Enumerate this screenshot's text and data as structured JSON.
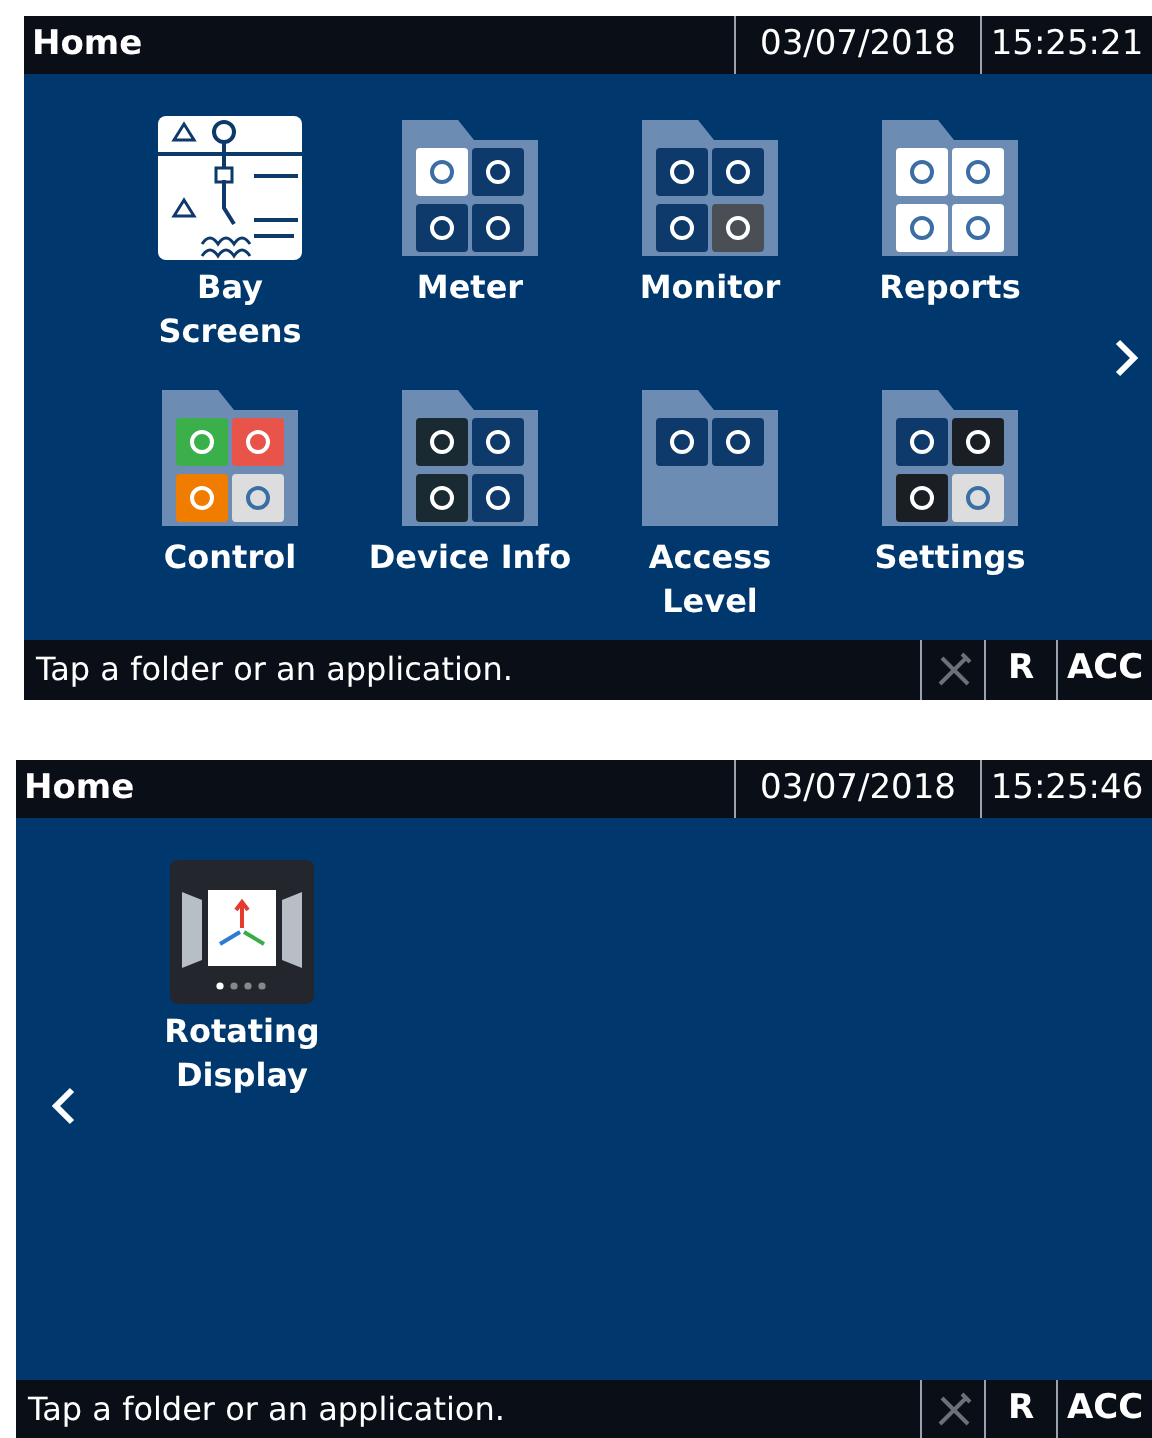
{
  "screens": [
    {
      "title": "Home",
      "date": "03/07/2018",
      "time": "15:25:21",
      "has_next_page": true,
      "has_previous_page": false,
      "items": [
        {
          "label": "Bay\nScreens",
          "kind": "diagram"
        },
        {
          "label": "Meter",
          "kind": "folder"
        },
        {
          "label": "Monitor",
          "kind": "folder"
        },
        {
          "label": "Reports",
          "kind": "folder"
        },
        {
          "label": "Control",
          "kind": "folder"
        },
        {
          "label": "Device Info",
          "kind": "folder"
        },
        {
          "label": "Access\nLevel",
          "kind": "folder"
        },
        {
          "label": "Settings",
          "kind": "folder"
        }
      ],
      "status": {
        "message": "Tap a folder or an application.",
        "indicators": [
          "R",
          "ACC"
        ]
      }
    },
    {
      "title": "Home",
      "date": "03/07/2018",
      "time": "15:25:46",
      "has_next_page": false,
      "has_previous_page": true,
      "items": [
        {
          "label": "Rotating\nDisplay",
          "kind": "app"
        }
      ],
      "status": {
        "message": "Tap a folder or an application.",
        "indicators": [
          "R",
          "ACC"
        ]
      }
    }
  ]
}
